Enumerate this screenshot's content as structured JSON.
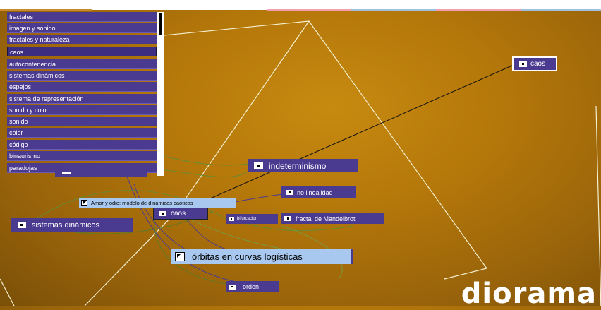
{
  "menu": {
    "items": [
      {
        "label": "fractales"
      },
      {
        "label": "imagen y sonido"
      },
      {
        "label": "fractales y naturaleza"
      },
      {
        "label": "caos",
        "selected": true
      },
      {
        "label": "autocontenencia"
      },
      {
        "label": "sistemas dinámicos"
      },
      {
        "label": "espejos"
      },
      {
        "label": "sistema de representación"
      },
      {
        "label": "sonido y color"
      },
      {
        "label": "sonido"
      },
      {
        "label": "color"
      },
      {
        "label": "código"
      },
      {
        "label": "binaurismo"
      },
      {
        "label": "paradojas"
      }
    ]
  },
  "nodes": {
    "caos_top": "caos",
    "indeterminismo": "indeterminismo",
    "no_linealidad": "no linealidad",
    "amor_y_odio": "Amor y odio: modelo de dinámicas caóticas",
    "caos_center": "caos",
    "bifurcacion": "bifurcacion",
    "fractal_mandelbrot": "fractal de Mandelbrot",
    "sistemas_dinamicos": "sistemas dinámicos",
    "orbitas": "órbitas en curvas logísticas",
    "orden": "orden"
  },
  "logo": "diorama",
  "colors": {
    "node_purple": "#4a3a90",
    "node_light_blue": "#a8c8f0",
    "background_gold": "#b5780a"
  },
  "icons": [
    "square-bullet-icon",
    "cursor-arrow-icon",
    "scroll-thumb"
  ]
}
